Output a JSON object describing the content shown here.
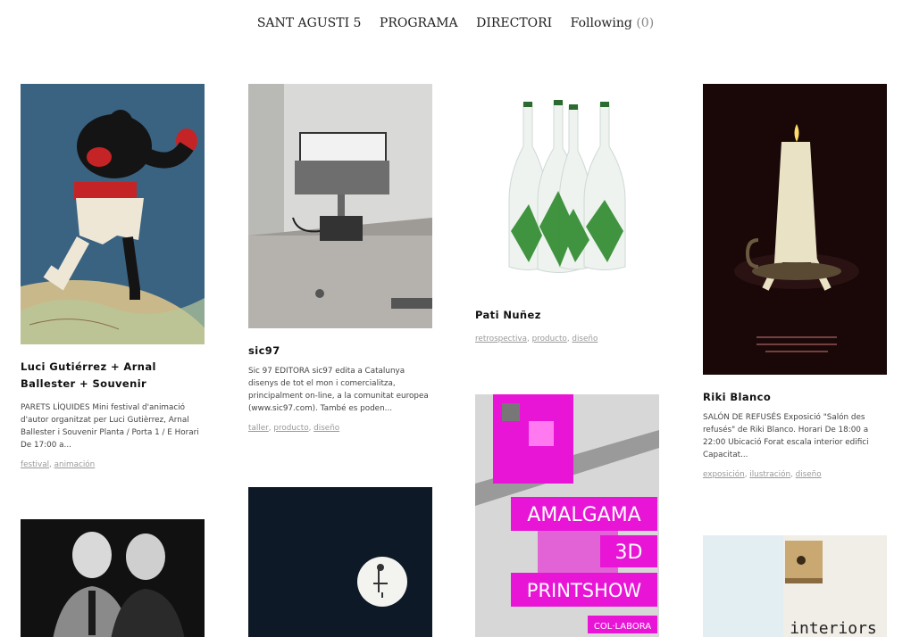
{
  "nav": {
    "items": [
      "SANT AGUSTI 5",
      "PROGRAMA",
      "DIRECTORI"
    ],
    "following_label": "Following",
    "following_count": "(0)"
  },
  "cards": [
    {
      "title": "Luci Gutiérrez + Arnal Ballester + Souvenir",
      "description": "PARETS LÍQUIDES Mini festival d'animació d'autor organitzat per Luci Gutièrrez, Arnal Ballester i Souvenir Planta / Porta 1 / E Horari De 17:00 a...",
      "tags": [
        "festival",
        "animación"
      ]
    },
    {
      "title": "sic97",
      "description": "Sic 97 EDITORA sic97 edita a Catalunya disenys de tot el mon i comercialitza, principalment on-line, a la comunitat europea (www.sic97.com). També es poden...",
      "tags": [
        "taller",
        "producto",
        "diseño"
      ]
    },
    {
      "title": "Pati Nuñez",
      "description": "",
      "tags": [
        "retrospectiva",
        "producto",
        "diseño"
      ]
    },
    {
      "title": "Riki Blanco",
      "description": "SALÓN DE REFUSÉS Exposició \"Salón des refusés\" de Riki Blanco. Horari De 18:00 a 22:00 Ubicació Forat escala interior edifici Capacitat...",
      "tags": [
        "exposición",
        "ilustración",
        "diseño"
      ]
    }
  ],
  "poster_texts": {
    "amalgama_1": "AMALGAMA",
    "amalgama_2": "3D",
    "amalgama_3": "PRINTSHOW",
    "amalgama_4": "COL·LABORA",
    "interiors": "interiors"
  },
  "colors": {
    "accent_magenta": "#e815d6",
    "tag": "#999999"
  }
}
